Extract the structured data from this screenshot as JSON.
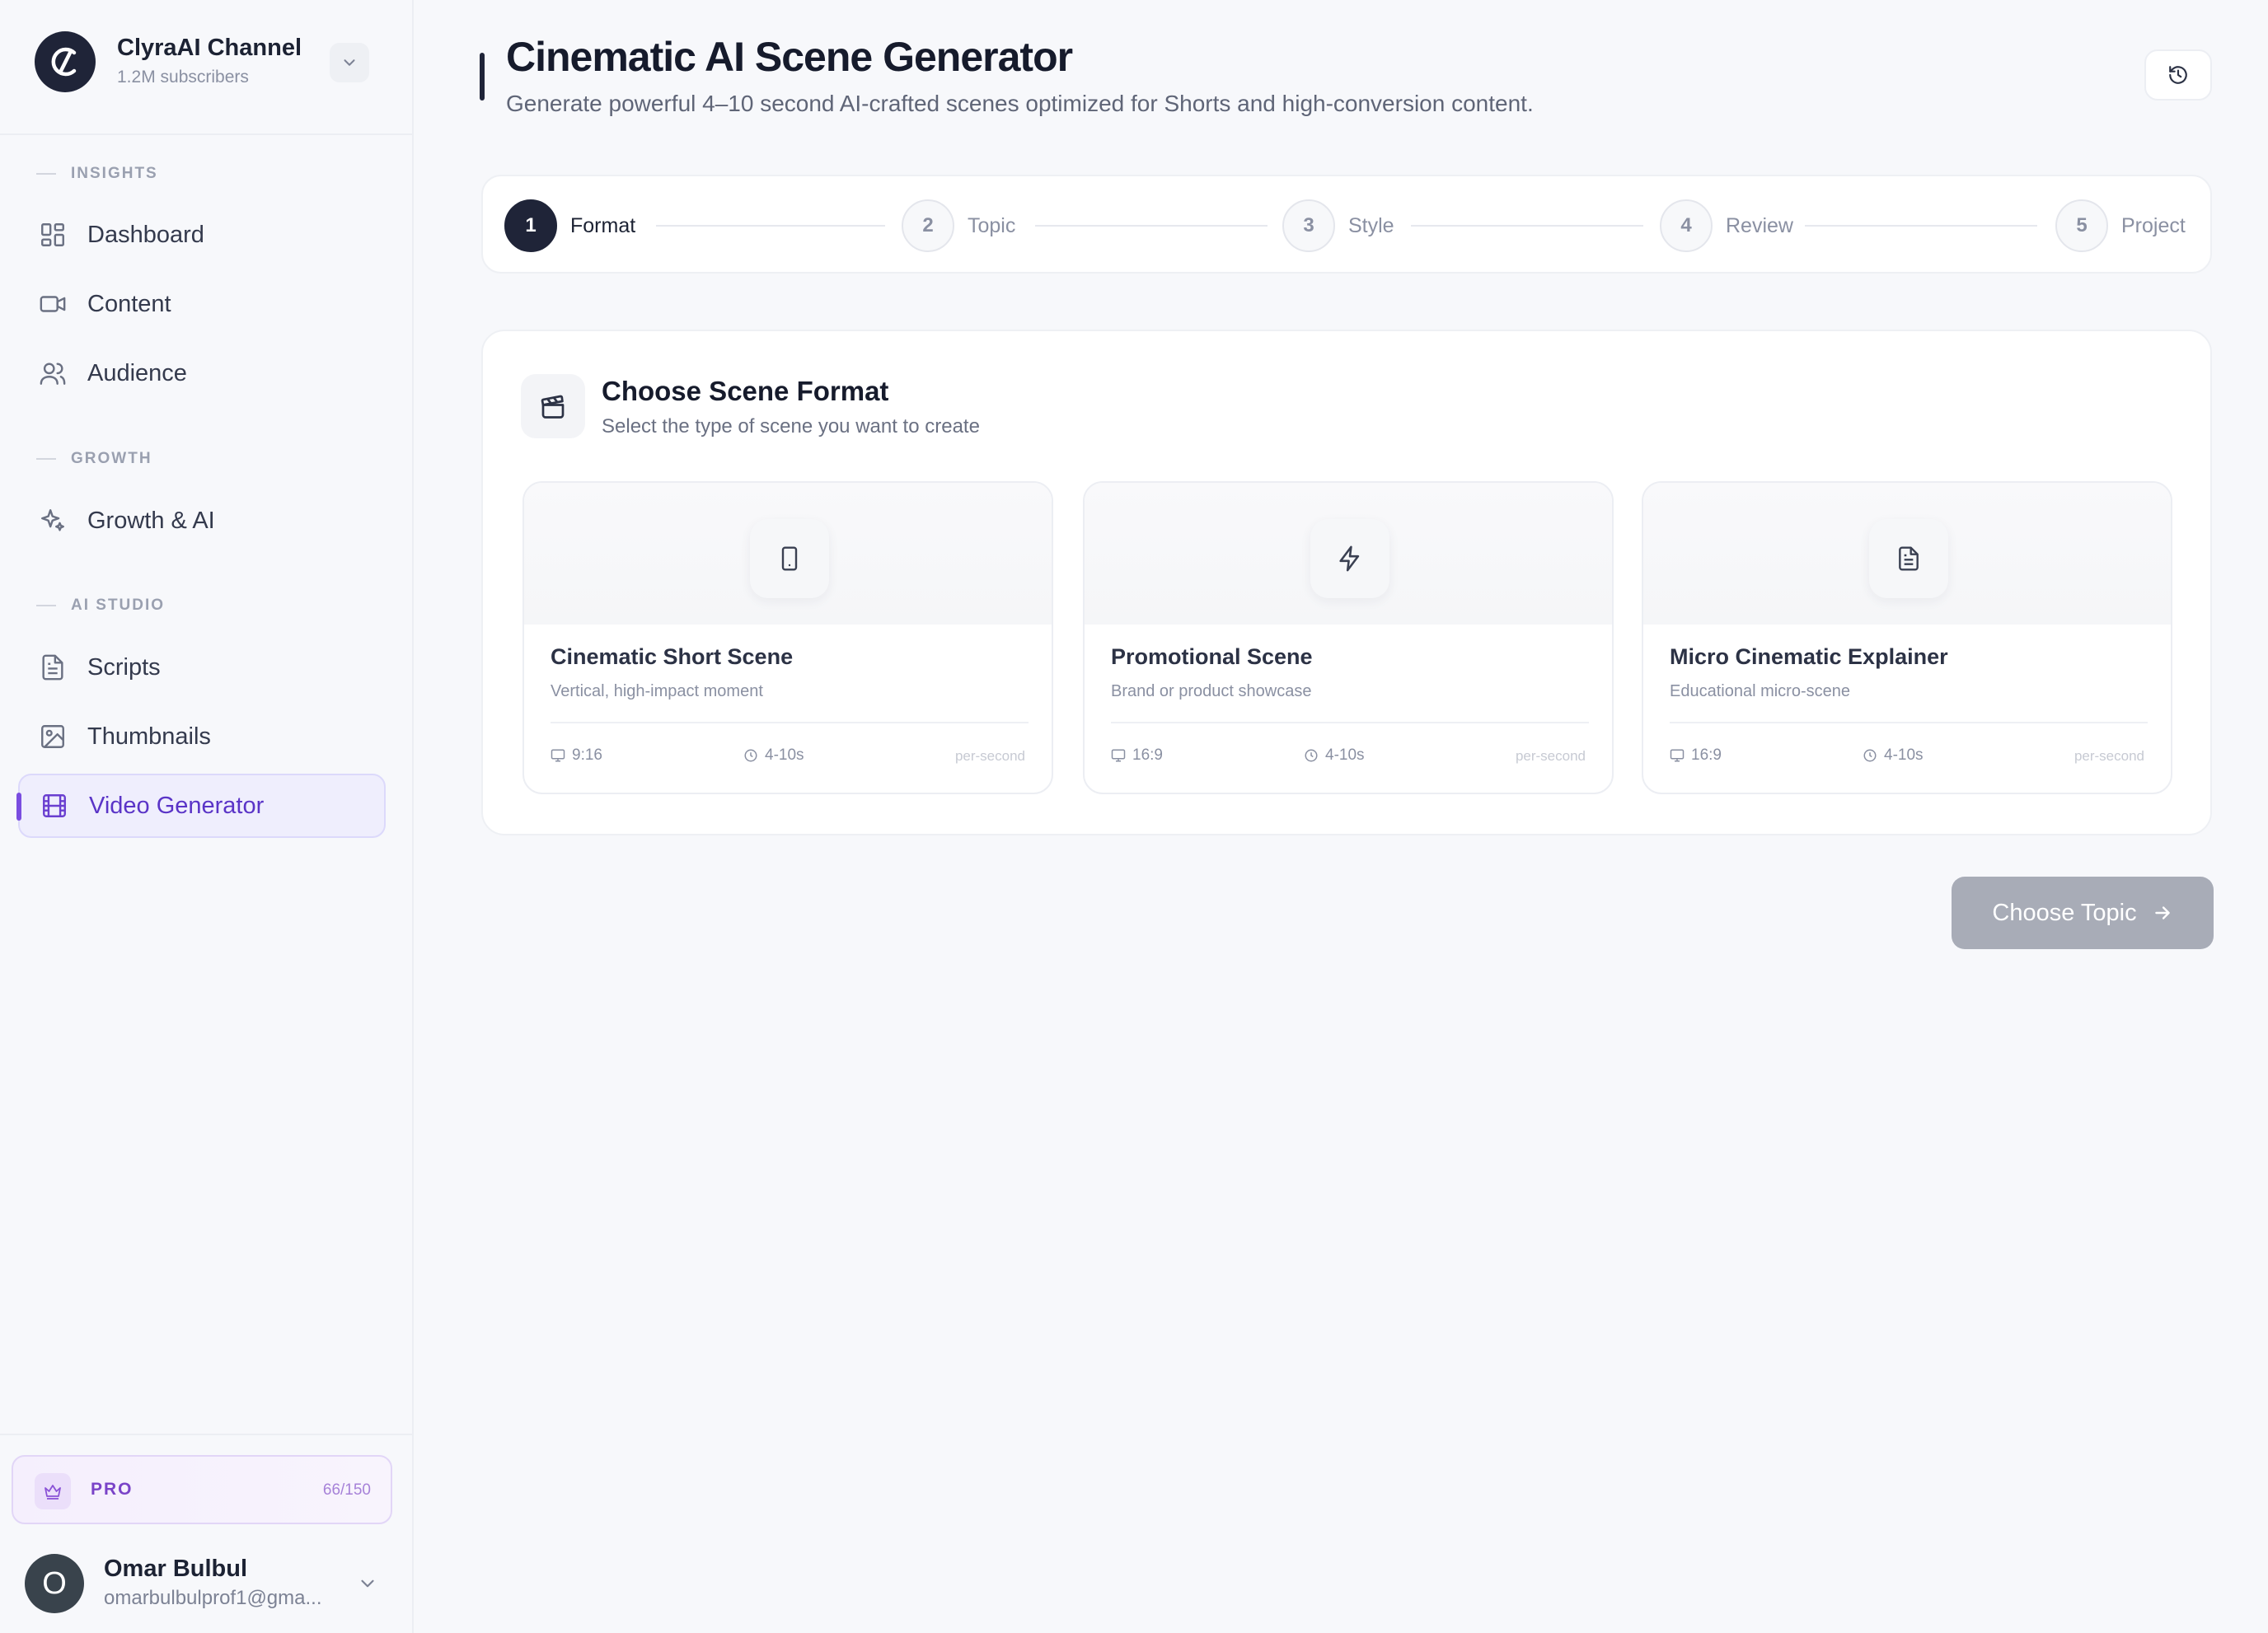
{
  "channel": {
    "name": "ClyraAI Channel",
    "subscribers": "1.2M subscribers"
  },
  "sidebar": {
    "sections": [
      {
        "label": "INSIGHTS"
      },
      {
        "label": "GROWTH"
      },
      {
        "label": "AI STUDIO"
      }
    ],
    "items": [
      {
        "label": "Dashboard",
        "icon": "dashboard-icon"
      },
      {
        "label": "Content",
        "icon": "video-camera-icon"
      },
      {
        "label": "Audience",
        "icon": "users-icon"
      },
      {
        "label": "Growth & AI",
        "icon": "sparkles-icon"
      },
      {
        "label": "Scripts",
        "icon": "file-text-icon"
      },
      {
        "label": "Thumbnails",
        "icon": "image-icon"
      },
      {
        "label": "Video Generator",
        "icon": "film-icon",
        "active": true
      }
    ],
    "plan": {
      "label": "PRO",
      "usage": "66/150"
    },
    "user": {
      "initial": "O",
      "name": "Omar Bulbul",
      "email": "omarbulbulprof1@gma..."
    }
  },
  "header": {
    "title": "Cinematic AI Scene Generator",
    "subtitle": "Generate powerful 4–10 second AI-crafted scenes optimized for Shorts and high-conversion content."
  },
  "stepper": {
    "steps": [
      {
        "number": "1",
        "label": "Format",
        "active": true
      },
      {
        "number": "2",
        "label": "Topic"
      },
      {
        "number": "3",
        "label": "Style"
      },
      {
        "number": "4",
        "label": "Review"
      },
      {
        "number": "5",
        "label": "Project"
      }
    ]
  },
  "format": {
    "title": "Choose Scene Format",
    "subtitle": "Select the type of scene you want to create",
    "options": [
      {
        "name": "Cinematic Short Scene",
        "desc": "Vertical, high-impact moment",
        "ratio": "9:16",
        "duration": "4-10s",
        "note": "per-second",
        "icon": "smartphone-icon"
      },
      {
        "name": "Promotional Scene",
        "desc": "Brand or product showcase",
        "ratio": "16:9",
        "duration": "4-10s",
        "note": "per-second",
        "icon": "lightning-icon"
      },
      {
        "name": "Micro Cinematic Explainer",
        "desc": "Educational micro-scene",
        "ratio": "16:9",
        "duration": "4-10s",
        "note": "per-second",
        "icon": "document-icon"
      }
    ]
  },
  "actions": {
    "next_label": "Choose Topic"
  },
  "colors": {
    "accent": "#5a34c7",
    "dark": "#1f2438",
    "pro": "#7a43c8",
    "disabled_button": "#a8acb7"
  }
}
